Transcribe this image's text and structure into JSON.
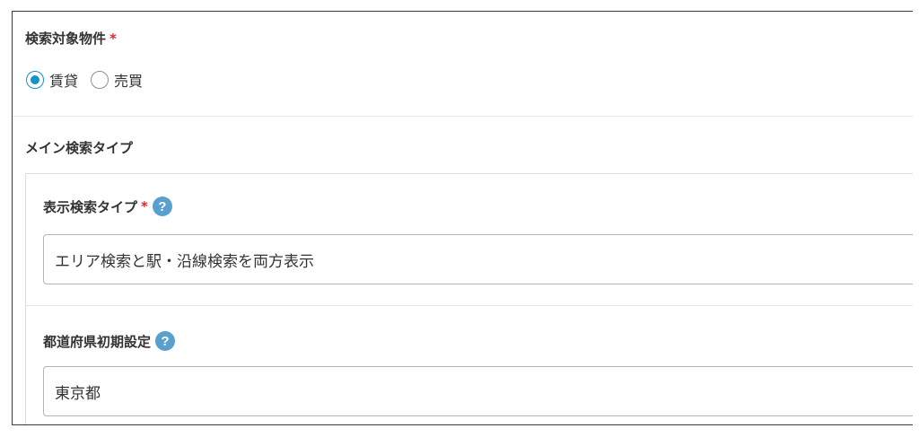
{
  "search_target": {
    "label": "検索対象物件",
    "required_mark": "*",
    "options": [
      {
        "label": "賃貸",
        "checked": true
      },
      {
        "label": "売買",
        "checked": false
      }
    ]
  },
  "main_search_type": {
    "heading": "メイン検索タイプ",
    "display_search_type": {
      "label": "表示検索タイプ",
      "required_mark": "*",
      "help_icon": "question-mark-icon",
      "value": "エリア検索と駅・沿線検索を両方表示"
    },
    "prefecture_default": {
      "label": "都道府県初期設定",
      "help_icon": "question-mark-icon",
      "value": "東京都"
    }
  },
  "colors": {
    "accent": "#1592c9",
    "required": "#e5242b",
    "help_icon_bg": "#5aa0cf"
  }
}
